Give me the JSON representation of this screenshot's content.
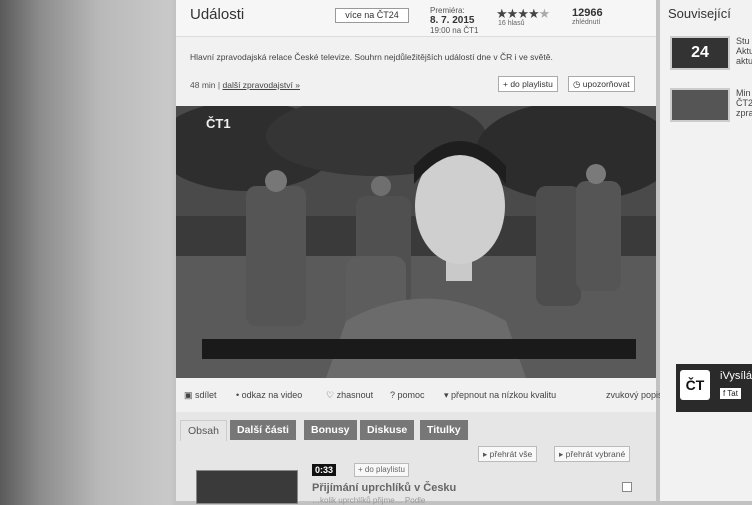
{
  "header": {
    "title": "Události",
    "more_label": "více na ČT24",
    "premiere_label": "Premiéra:",
    "premiere_date": "8. 7. 2015",
    "premiere_time": "19:00 na ČT1",
    "rating_stars": 4,
    "rating_votes": "16 hlasů",
    "views": "12966",
    "views_label": "zhlédnutí"
  },
  "description": "Hlavní zpravodajská relace České televize. Souhrn nejdůležitějších událostí dne v ČR i ve světě.",
  "meta": {
    "duration": "48 min",
    "separator": "|",
    "more_news_link": "další zpravodajství »"
  },
  "actions": {
    "playlist": "+ do playlistu",
    "subscribe": "upozorňovat"
  },
  "player": {
    "channel_logo": "ČT1"
  },
  "toolbar": {
    "share": "sdílet",
    "link": "odkaz na video",
    "dim": "zhasnout",
    "help": "pomoc",
    "low_quality": "přepnout na nízkou kvalitu",
    "audio_description": "zvukový popis"
  },
  "tabs": [
    {
      "label": "Obsah"
    },
    {
      "label": "Další části"
    },
    {
      "label": "Bonusy"
    },
    {
      "label": "Diskuse"
    },
    {
      "label": "Titulky"
    }
  ],
  "list_controls": {
    "play_all": "přehrát vše",
    "play_selected": "přehrát vybrané"
  },
  "video_item": {
    "duration": "0:33",
    "playlist": "+ do playlistu",
    "title": "Přijímání uprchlíků v Česku",
    "snippet": "…kolik uprchlíků přijme… Podle"
  },
  "sidebar": {
    "title": "Související",
    "items": [
      {
        "thumb": "24",
        "line1": "Stu",
        "line2": "Aktu",
        "line3": "aktu"
      },
      {
        "thumb": "",
        "line1": "Min",
        "line2": "ČT2",
        "line3": "zpra"
      }
    ]
  },
  "ivysilani": {
    "logo": "ČT",
    "label": "iVysílá",
    "fb": "f Tat"
  }
}
